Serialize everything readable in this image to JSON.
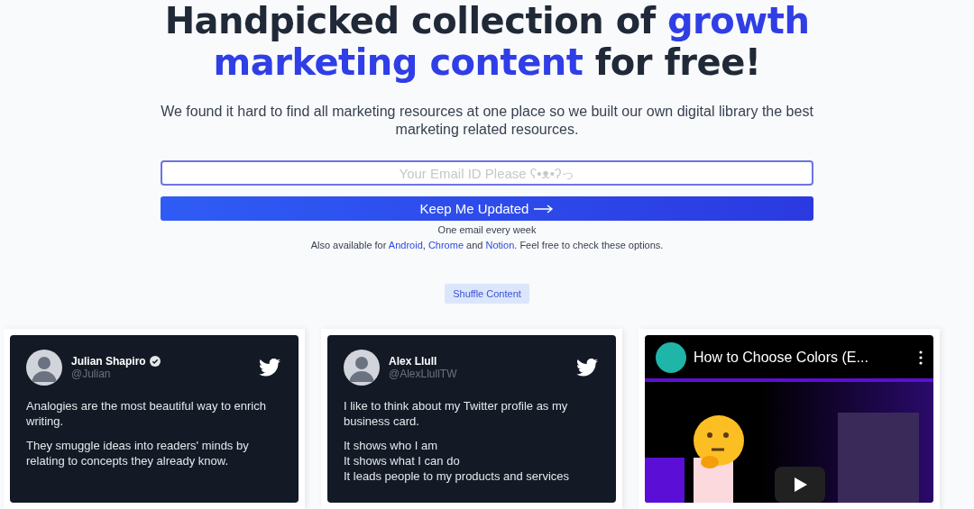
{
  "headline": {
    "lines": [
      [
        {
          "text": "Handpicked collection of ",
          "accent": false
        },
        {
          "text": "growth",
          "accent": true
        }
      ],
      [
        {
          "text": "marketing content",
          "accent": true
        },
        {
          "text": " for free!",
          "accent": false
        }
      ]
    ]
  },
  "subtitle": "We found it hard to find all marketing resources at one place so we built our own digital library the best marketing related resources.",
  "email": {
    "placeholder": "Your Email ID Please ʕ•ᴥ•ʔっ"
  },
  "subscribe_button": "Keep Me Updated",
  "frequency_note": "One email every week",
  "availability": [
    {
      "text": "Also available for ",
      "link": false
    },
    {
      "text": "Android",
      "link": true
    },
    {
      "text": ", ",
      "link": false
    },
    {
      "text": "Chrome",
      "link": true
    },
    {
      "text": " and ",
      "link": false
    },
    {
      "text": "Notion",
      "link": true
    },
    {
      "text": ". Feel free to check these options.",
      "link": false
    }
  ],
  "shuffle_button": "Shuffle Content",
  "cards": [
    {
      "kind": "tweet",
      "name": "Julian Shapiro",
      "handle": "@Julian",
      "verified": true,
      "paragraphs": [
        [
          "Analogies are the most beautiful way to enrich writing."
        ],
        [
          "They smuggle ideas into readers' minds by relating to concepts they already know."
        ]
      ]
    },
    {
      "kind": "tweet",
      "name": "Alex Llull",
      "handle": "@AlexLlullTW",
      "verified": false,
      "paragraphs": [
        [
          "I like to think about my Twitter profile as my business card."
        ],
        [
          "It shows who I am",
          "It shows what I can do",
          "It leads people to my products and services"
        ]
      ]
    },
    {
      "kind": "video",
      "title": "How to Choose Colors (E..."
    }
  ]
}
